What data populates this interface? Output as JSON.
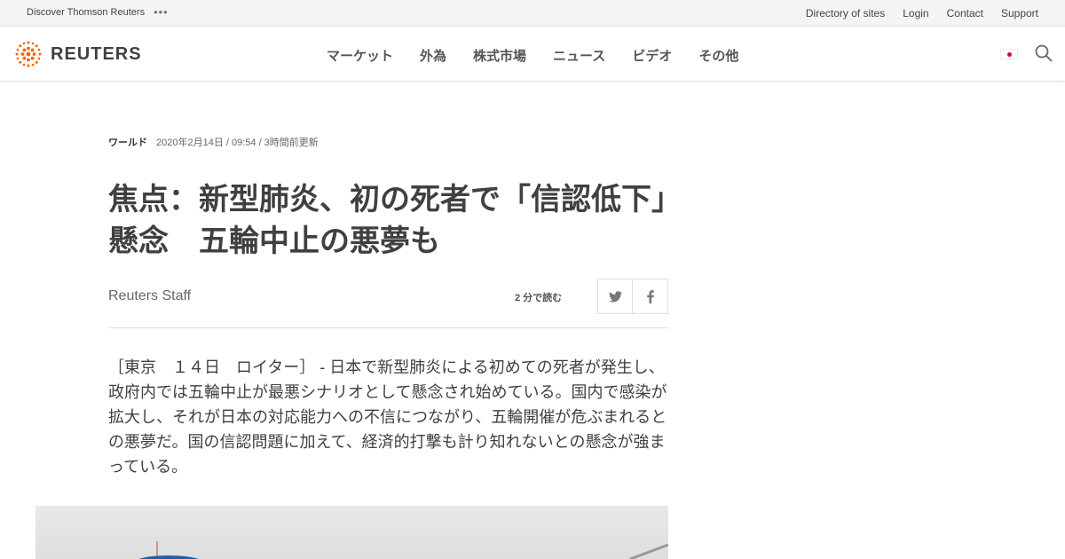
{
  "utility": {
    "discover": "Discover Thomson Reuters",
    "dots": "•••",
    "links": [
      "Directory of sites",
      "Login",
      "Contact",
      "Support"
    ]
  },
  "header": {
    "logo_text": "REUTERS",
    "nav": [
      "マーケット",
      "外為",
      "株式市場",
      "ニュース",
      "ビデオ",
      "その他"
    ],
    "flag_icon": "japan-flag-icon",
    "search_icon": "search-icon"
  },
  "article": {
    "section": "ワールド",
    "timestamp": "2020年2月14日 / 09:54 / 3時間前更新",
    "title": "焦点：新型肺炎、初の死者で「信認低下」懸念　五輪中止の悪夢も",
    "byline": "Reuters Staff",
    "read_time": "2  分で読む",
    "body": "［東京　１４日　ロイター］ - 日本で新型肺炎による初めての死者が発生し、政府内では五輪中止が最悪シナリオとして懸念され始めている。国内で感染が拡大し、それが日本の対応能力への不信につながり、五輪開催が危ぶまれるとの悪夢だ。国の信認問題に加えて、経済的打撃も計り知れないとの懸念が強まっている。"
  },
  "colors": {
    "logo_orange": "#fa6400",
    "text": "#404040",
    "flag_red": "#c8102e"
  }
}
